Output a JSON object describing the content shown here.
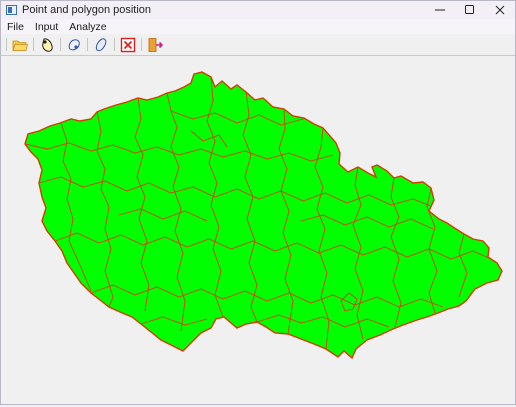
{
  "window": {
    "title": "Point and polygon position"
  },
  "title_controls": {
    "minimize": "—",
    "maximize": "☐",
    "close": "✕"
  },
  "menu": [
    {
      "label": "File"
    },
    {
      "label": "Input"
    },
    {
      "label": "Analyze"
    }
  ],
  "toolbar": [
    {
      "icon": "folder-open-icon"
    },
    {
      "icon": "point-in-polygon-icon"
    },
    {
      "icon": "point-polygon-alt-icon"
    },
    {
      "icon": "polygon-icon"
    },
    {
      "icon": "clear-icon"
    },
    {
      "icon": "exit-icon"
    }
  ],
  "map": {
    "fill_color": "#00ff00",
    "border_color": "#d83a00"
  }
}
